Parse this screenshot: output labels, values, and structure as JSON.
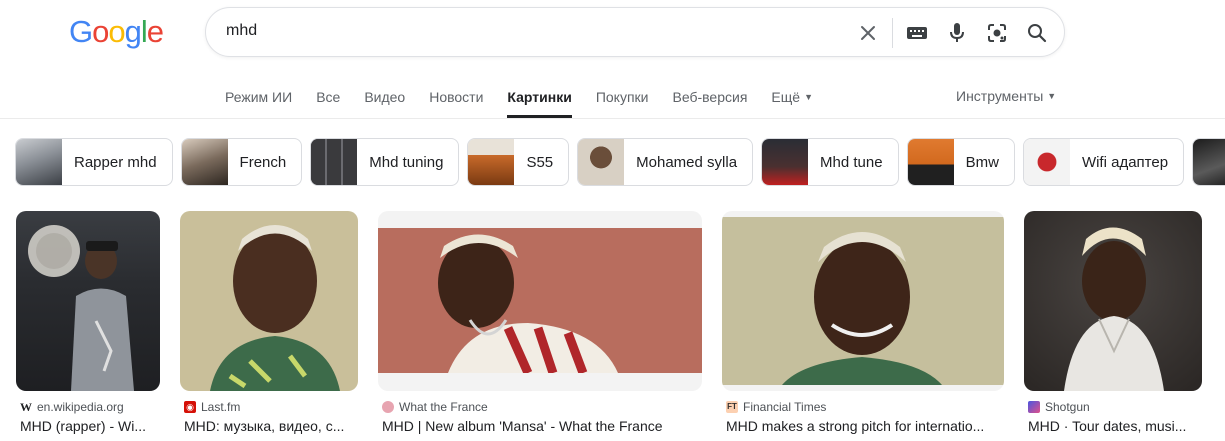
{
  "logo": {
    "letters": [
      "G",
      "o",
      "o",
      "g",
      "l",
      "e"
    ],
    "colors": [
      "#4285f4",
      "#ea4335",
      "#fbbc05",
      "#4285f4",
      "#34a853",
      "#ea4335"
    ]
  },
  "search": {
    "value": "mhd",
    "icons": [
      "close-icon",
      "keyboard-icon",
      "microphone-icon",
      "camera-lens-icon",
      "search-icon"
    ]
  },
  "tabs": [
    {
      "label": "Режим ИИ",
      "active": false
    },
    {
      "label": "Все",
      "active": false
    },
    {
      "label": "Видео",
      "active": false
    },
    {
      "label": "Новости",
      "active": false
    },
    {
      "label": "Картинки",
      "active": true
    },
    {
      "label": "Покупки",
      "active": false
    },
    {
      "label": "Веб-версия",
      "active": false
    },
    {
      "label": "Ещё",
      "active": false,
      "dropdown": true
    }
  ],
  "tools_label": "Инструменты",
  "chips": [
    {
      "label": "Rapper mhd",
      "thumb": "#8a8f96"
    },
    {
      "label": "French",
      "thumb": "#7a6a5c"
    },
    {
      "label": "Mhd tuning",
      "thumb": "#3a3a3d"
    },
    {
      "label": "S55",
      "thumb": "#c86a2a"
    },
    {
      "label": "Mohamed sylla",
      "thumb": "#9a8a7a"
    },
    {
      "label": "Mhd tune",
      "thumb": "#2a2d35"
    },
    {
      "label": "Bmw",
      "thumb": "#d2691e"
    },
    {
      "label": "Wifi адаптер",
      "thumb": "#c8282c"
    },
    {
      "label": "",
      "thumb": "#1c1c1c"
    }
  ],
  "results": [
    {
      "source": "en.wikipedia.org",
      "title": "MHD (rapper) - Wi...",
      "fav_color": "#ffffff",
      "fav_text": "W",
      "fav_fg": "#202124"
    },
    {
      "source": "Last.fm",
      "title": "MHD: музыка, видео, с...",
      "fav_color": "#d51007",
      "fav_text": "",
      "fav_fg": "#ffffff"
    },
    {
      "source": "What the France",
      "title": "MHD | New album 'Mansa' - What the France",
      "fav_color": "#e7a4b0",
      "fav_text": "",
      "fav_fg": "#ffffff"
    },
    {
      "source": "Financial Times",
      "title": "MHD makes a strong pitch for internatio...",
      "fav_color": "#fcd0b1",
      "fav_text": "FT",
      "fav_fg": "#33302e"
    },
    {
      "source": "Shotgun",
      "title": "MHD · Tour dates, musi...",
      "fav_color": "#4a55e0",
      "fav_text": "",
      "fav_fg": "#ffffff"
    }
  ]
}
